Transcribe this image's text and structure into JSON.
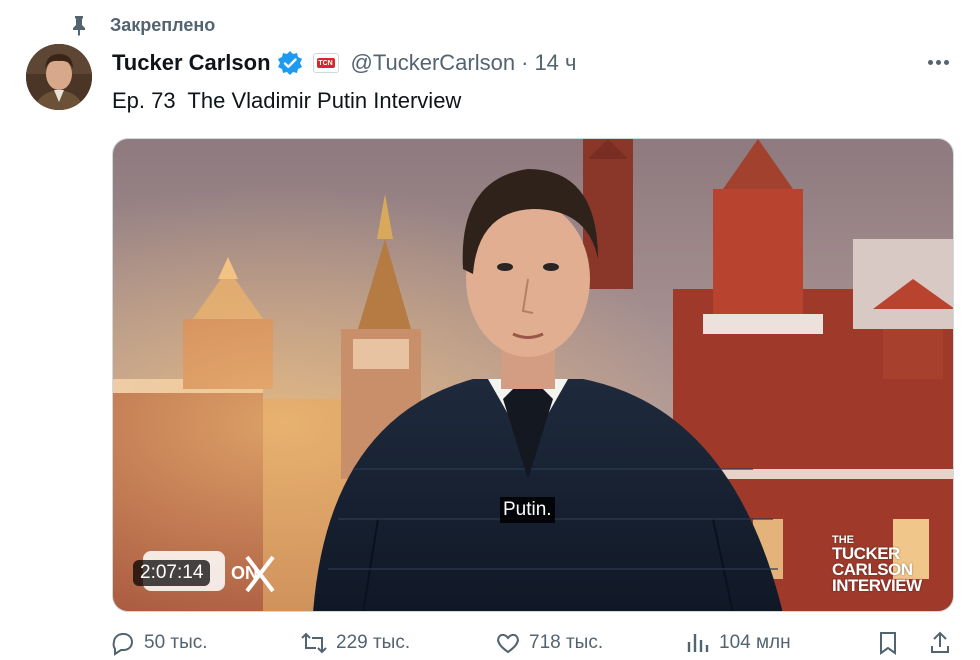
{
  "pinned": {
    "label": "Закреплено",
    "icon": "pin-icon"
  },
  "author": {
    "name": "Tucker Carlson",
    "handle": "@TuckerCarlson",
    "separator": "·",
    "time": "14 ч",
    "verified_icon": "verified-badge-icon",
    "affiliation_icon": "tcn-affiliate-badge",
    "affiliation_text": "TCN"
  },
  "tweet": {
    "text": "Ep. 73  The Vladimir Putin Interview"
  },
  "video": {
    "subtitle": "Putin.",
    "duration": "2:07:14",
    "watermark_line1": "THE",
    "watermark_line2": "TUCKER",
    "watermark_line3": "CARLSON",
    "watermark_line4": "INTERVIEW",
    "corner_logo": "ON"
  },
  "actions": {
    "replies": "50 тыс.",
    "reposts": "229 тыс.",
    "likes": "718 тыс.",
    "views": "104 млн"
  },
  "colors": {
    "verified": "#1d9bf0",
    "muted_text": "#536471",
    "primary_text": "#0f1419"
  }
}
